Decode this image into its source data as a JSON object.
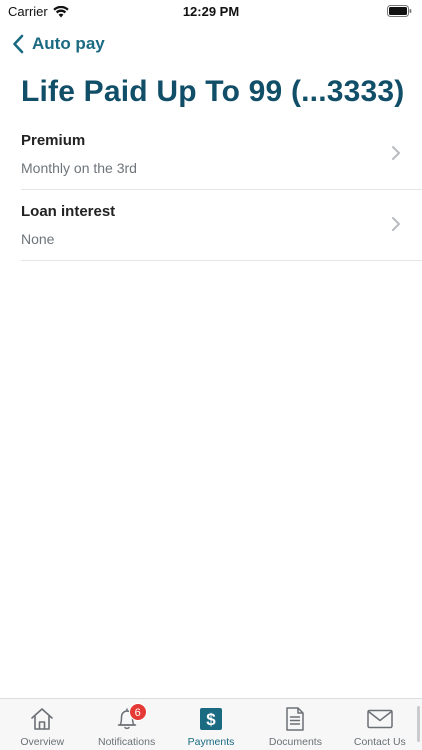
{
  "status_bar": {
    "carrier": "Carrier",
    "time": "12:29 PM"
  },
  "nav": {
    "back_label": "Auto pay",
    "back_icon": "chevron-left-icon"
  },
  "page": {
    "title": "Life Paid Up To 99 (...3333)"
  },
  "items": [
    {
      "title": "Premium",
      "subtitle": "Monthly on the 3rd"
    },
    {
      "title": "Loan interest",
      "subtitle": "None"
    }
  ],
  "tabs": [
    {
      "label": "Overview",
      "icon": "home-icon",
      "active": false
    },
    {
      "label": "Notifications",
      "icon": "bell-icon",
      "badge": "6",
      "active": false
    },
    {
      "label": "Payments",
      "icon": "dollar-icon",
      "active": true
    },
    {
      "label": "Documents",
      "icon": "document-icon",
      "active": false
    },
    {
      "label": "Contact Us",
      "icon": "mail-icon",
      "active": false
    }
  ],
  "colors": {
    "accent": "#1a6a82",
    "title": "#114e68",
    "badge": "#e53935"
  }
}
